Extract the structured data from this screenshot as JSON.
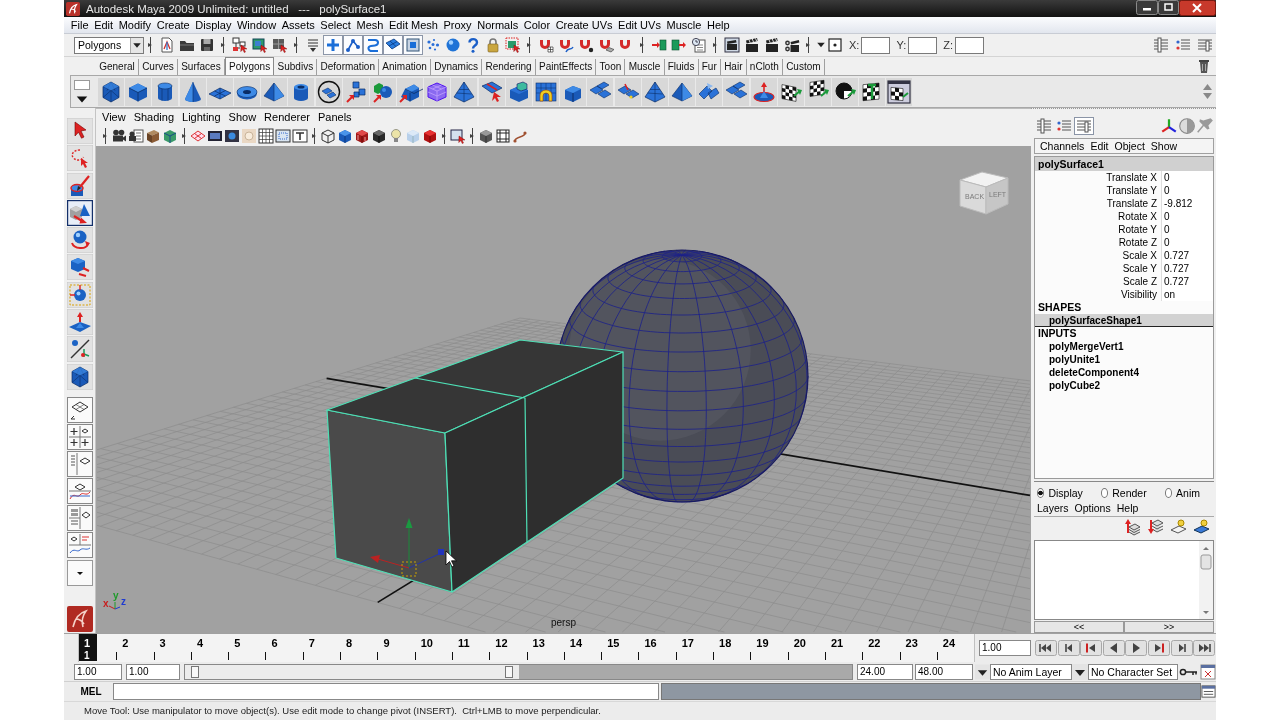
{
  "window": {
    "title": "Autodesk Maya 2009 Unlimited: untitled   ---   polySurface1"
  },
  "menu_bar": [
    "File",
    "Edit",
    "Modify",
    "Create",
    "Display",
    "Window",
    "Assets",
    "Select",
    "Mesh",
    "Edit Mesh",
    "Proxy",
    "Normals",
    "Color",
    "Create UVs",
    "Edit UVs",
    "Muscle",
    "Help"
  ],
  "status_line": {
    "menu_set": "Polygons",
    "selection_mask": [
      {
        "on": true
      },
      {
        "on": true
      },
      {
        "on": true
      },
      {
        "on": true
      },
      {
        "on": true
      },
      {
        "on": false
      },
      {
        "on": false
      },
      {
        "on": false
      }
    ],
    "input_fields": [
      {
        "label": "X:"
      },
      {
        "label": "Y:"
      },
      {
        "label": "Z:"
      }
    ]
  },
  "shelf": {
    "tabs": [
      {
        "label": "General",
        "selected": false
      },
      {
        "label": "Curves",
        "selected": false
      },
      {
        "label": "Surfaces",
        "selected": false
      },
      {
        "label": "Polygons",
        "selected": true
      },
      {
        "label": "Subdivs",
        "selected": false
      },
      {
        "label": "Deformation",
        "selected": false
      },
      {
        "label": "Animation",
        "selected": false
      },
      {
        "label": "Dynamics",
        "selected": false
      },
      {
        "label": "Rendering",
        "selected": false
      },
      {
        "label": "PaintEffects",
        "selected": false
      },
      {
        "label": "Toon",
        "selected": false
      },
      {
        "label": "Muscle",
        "selected": false
      },
      {
        "label": "Fluids",
        "selected": false
      },
      {
        "label": "Fur",
        "selected": false
      },
      {
        "label": "Hair",
        "selected": false
      },
      {
        "label": "nCloth",
        "selected": false
      },
      {
        "label": "Custom",
        "selected": false
      }
    ]
  },
  "toolbox": {
    "tools": [
      {
        "selected": false
      },
      {
        "selected": false
      },
      {
        "selected": false
      },
      {
        "selected": true
      },
      {
        "selected": false
      },
      {
        "selected": false
      },
      {
        "selected": false
      },
      {
        "selected": false
      },
      {
        "selected": false
      },
      {
        "selected": false
      }
    ]
  },
  "viewport": {
    "menu": [
      "View",
      "Shading",
      "Lighting",
      "Show",
      "Renderer",
      "Panels"
    ],
    "view_cube": [
      "BACK",
      "LEFT"
    ],
    "axes": [
      "x",
      "y",
      "z"
    ],
    "camera": "persp"
  },
  "channel_box": {
    "mode_buttons": [
      {
        "selected": false
      },
      {
        "selected": false
      },
      {
        "selected": true
      }
    ],
    "menu": [
      "Channels",
      "Edit",
      "Object",
      "Show"
    ],
    "object": "polySurface1",
    "attributes": [
      {
        "name": "Translate X",
        "value": "0"
      },
      {
        "name": "Translate Y",
        "value": "0"
      },
      {
        "name": "Translate Z",
        "value": "-9.812"
      },
      {
        "name": "Rotate X",
        "value": "0"
      },
      {
        "name": "Rotate Y",
        "value": "0"
      },
      {
        "name": "Rotate Z",
        "value": "0"
      },
      {
        "name": "Scale X",
        "value": "0.727"
      },
      {
        "name": "Scale Y",
        "value": "0.727"
      },
      {
        "name": "Scale Z",
        "value": "0.727"
      },
      {
        "name": "Visibility",
        "value": "on"
      }
    ],
    "shapes": {
      "title": "SHAPES",
      "items": [
        {
          "name": "polySurfaceShape1",
          "selected": true
        }
      ]
    },
    "inputs": {
      "title": "INPUTS",
      "items": [
        {
          "name": "polyMergeVert1",
          "selected": false
        },
        {
          "name": "polyUnite1",
          "selected": false
        },
        {
          "name": "deleteComponent4",
          "selected": false
        },
        {
          "name": "polyCube2",
          "selected": false
        }
      ]
    }
  },
  "layer_editor": {
    "modes": [
      {
        "label": "Display",
        "selected": true
      },
      {
        "label": "Render",
        "selected": false
      },
      {
        "label": "Anim",
        "selected": false
      }
    ],
    "menu": [
      "Layers",
      "Options",
      "Help"
    ],
    "page_buttons": [
      "<<",
      ">>"
    ]
  },
  "time_slider": {
    "frames": [
      {
        "label": "1",
        "selected": true
      },
      {
        "label": "2",
        "selected": false
      },
      {
        "label": "3",
        "selected": false
      },
      {
        "label": "4",
        "selected": false
      },
      {
        "label": "5",
        "selected": false
      },
      {
        "label": "6",
        "selected": false
      },
      {
        "label": "7",
        "selected": false
      },
      {
        "label": "8",
        "selected": false
      },
      {
        "label": "9",
        "selected": false
      },
      {
        "label": "10",
        "selected": false
      },
      {
        "label": "11",
        "selected": false
      },
      {
        "label": "12",
        "selected": false
      },
      {
        "label": "13",
        "selected": false
      },
      {
        "label": "14",
        "selected": false
      },
      {
        "label": "15",
        "selected": false
      },
      {
        "label": "16",
        "selected": false
      },
      {
        "label": "17",
        "selected": false
      },
      {
        "label": "18",
        "selected": false
      },
      {
        "label": "19",
        "selected": false
      },
      {
        "label": "20",
        "selected": false
      },
      {
        "label": "21",
        "selected": false
      },
      {
        "label": "22",
        "selected": false
      },
      {
        "label": "23",
        "selected": false
      },
      {
        "label": "24",
        "selected": false
      }
    ],
    "current_frame": "1",
    "current_time": "1.00"
  },
  "range_slider": {
    "start_time": "1.00",
    "playback_start": "1.00",
    "level": 0.5,
    "playback_end": "24.00",
    "end_time": "48.00",
    "anim_layer": "No Anim Layer",
    "character_set": "No Character Set"
  },
  "command_line": {
    "language": "MEL"
  },
  "help_line": "Move Tool: Use manipulator to move object(s). Use edit mode to change pivot (INSERT).  Ctrl+LMB to move perpendicular."
}
